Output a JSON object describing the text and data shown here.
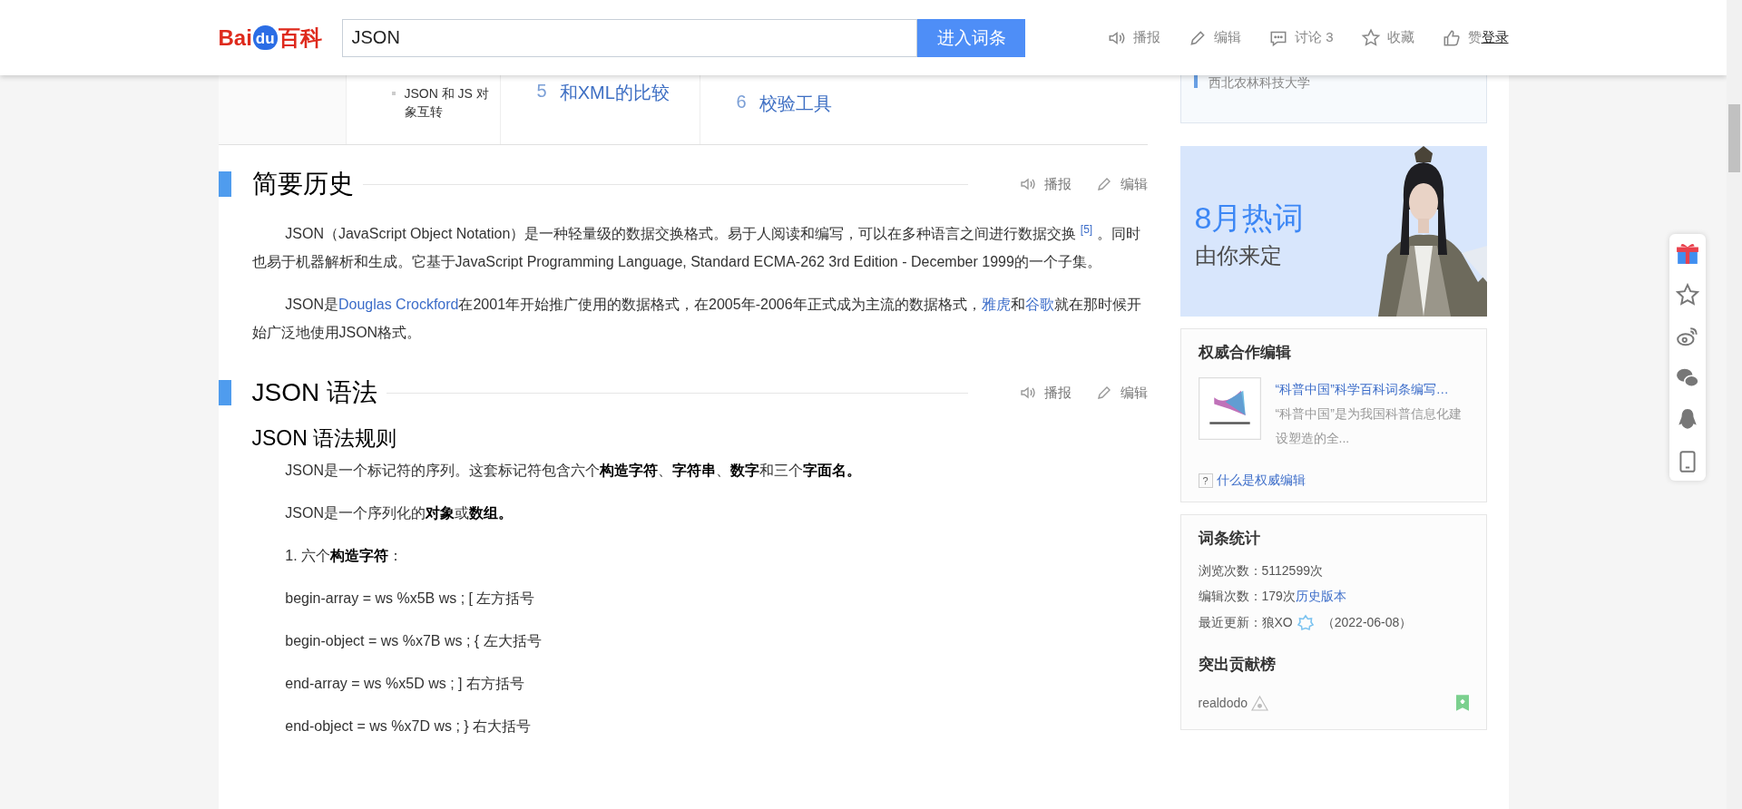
{
  "header": {
    "logo": {
      "text_1": "Bai",
      "badge": "du",
      "text_2": "百科"
    },
    "search": {
      "value": "JSON"
    },
    "search_button": "进入词条",
    "actions": [
      {
        "kind": "speaker",
        "label": "播报"
      },
      {
        "kind": "pencil",
        "label": "编辑"
      },
      {
        "kind": "comment",
        "label": "讨论 3"
      },
      {
        "kind": "star",
        "label": "收藏"
      },
      {
        "kind": "thumb",
        "label": "赞"
      }
    ],
    "login": "登录"
  },
  "toc": {
    "bullets": [
      "JSON 和 JS 对象互转"
    ],
    "items": [
      {
        "number": "5",
        "label": "和XML的比较"
      },
      {
        "number": "6",
        "label": "校验工具"
      }
    ]
  },
  "sections": [
    {
      "title": "简要历史",
      "tools": [
        {
          "kind": "speaker",
          "label": "播报"
        },
        {
          "kind": "pencil",
          "label": "编辑"
        }
      ],
      "blocks": [
        {
          "kind": "para",
          "segments": [
            {
              "kind": "text",
              "text": "JSON（JavaScript Object Notation）是一种轻量级的数据交换格式。易于人阅读和编写，可以在多种语言之间进行数据交换 "
            },
            {
              "kind": "ref",
              "text": "[5]"
            },
            {
              "kind": "text",
              "text": " 。同时也易于机器解析和生成。它基于JavaScript Programming Language, Standard ECMA-262 3rd Edition - December 1999的一个子集。"
            }
          ]
        },
        {
          "kind": "para",
          "segments": [
            {
              "kind": "text",
              "text": "JSON是"
            },
            {
              "kind": "link",
              "text": "Douglas Crockford"
            },
            {
              "kind": "text",
              "text": "在2001年开始推广使用的数据格式，在2005年-2006年正式成为主流的数据格式，"
            },
            {
              "kind": "link",
              "text": "雅虎"
            },
            {
              "kind": "text",
              "text": "和"
            },
            {
              "kind": "link",
              "text": "谷歌"
            },
            {
              "kind": "text",
              "text": "就在那时候开始广泛地使用JSON格式。"
            }
          ]
        }
      ]
    },
    {
      "title": "JSON 语法",
      "tools": [
        {
          "kind": "speaker",
          "label": "播报"
        },
        {
          "kind": "pencil",
          "label": "编辑"
        }
      ],
      "blocks": [
        {
          "kind": "subheading",
          "text": "JSON 语法规则"
        },
        {
          "kind": "para",
          "segments": [
            {
              "kind": "text",
              "text": "JSON是一个标记符的序列。这套标记符包含六个"
            },
            {
              "kind": "bold",
              "text": "构造字符"
            },
            {
              "kind": "text",
              "text": "、"
            },
            {
              "kind": "bold",
              "text": "字符串"
            },
            {
              "kind": "text",
              "text": "、"
            },
            {
              "kind": "bold",
              "text": "数字"
            },
            {
              "kind": "text",
              "text": "和三个"
            },
            {
              "kind": "bold",
              "text": "字面名。"
            }
          ]
        },
        {
          "kind": "para",
          "segments": [
            {
              "kind": "text",
              "text": "JSON是一个序列化的"
            },
            {
              "kind": "bold",
              "text": "对象"
            },
            {
              "kind": "text",
              "text": "或"
            },
            {
              "kind": "bold",
              "text": "数组。"
            }
          ]
        },
        {
          "kind": "para",
          "segments": [
            {
              "kind": "text",
              "text": "1. 六个"
            },
            {
              "kind": "bold",
              "text": "构造字符"
            },
            {
              "kind": "text",
              "text": "："
            }
          ]
        },
        {
          "kind": "para",
          "segments": [
            {
              "kind": "text",
              "text": "begin-array = ws %x5B ws ; [ 左方括号"
            }
          ]
        },
        {
          "kind": "para",
          "segments": [
            {
              "kind": "text",
              "text": "begin-object = ws %x7B ws ; { 左大括号"
            }
          ]
        },
        {
          "kind": "para",
          "segments": [
            {
              "kind": "text",
              "text": "end-array = ws %x5D ws ; ] 右方括号"
            }
          ]
        },
        {
          "kind": "para",
          "segments": [
            {
              "kind": "text",
              "text": "end-object = ws %x7D ws ; } 右大括号"
            }
          ]
        }
      ]
    }
  ],
  "sidebar": {
    "partial_card": {
      "text": "西北农林科技大学"
    },
    "banner": {
      "title": "8月热词",
      "subtitle": "由你来定",
      "kind": "picture"
    },
    "authority": {
      "title": "权威合作编辑",
      "org_title": "“科普中国”科学百科词条编写…",
      "org_desc": "“科普中国”是为我国科普信息化建设塑造的全...",
      "help_mark": "?",
      "help_link": "什么是权威编辑"
    },
    "stats": {
      "title": "词条统计",
      "views": {
        "label": "浏览次数：",
        "value": "5112599次"
      },
      "edits": {
        "label": "编辑次数：",
        "value": "179次",
        "link": "历史版本"
      },
      "update": {
        "label": "最近更新：",
        "user": "狼XO",
        "date": "（2022-06-08）"
      },
      "contrib_title": "突出贡献榜",
      "contributors": [
        {
          "name": "realdodo"
        }
      ]
    }
  },
  "float_tools": [
    {
      "kind": "gift"
    },
    {
      "kind": "star"
    },
    {
      "kind": "weibo"
    },
    {
      "kind": "wechat"
    },
    {
      "kind": "qq"
    },
    {
      "kind": "phone"
    }
  ]
}
